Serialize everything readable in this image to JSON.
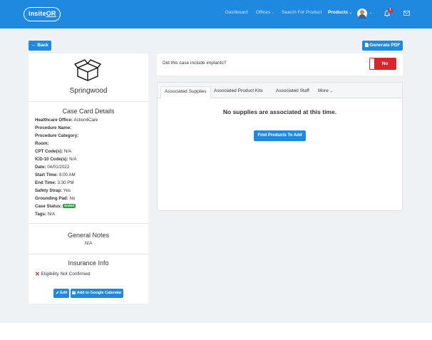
{
  "header": {
    "logo_text": "insite",
    "logo_or": "OR",
    "nav": [
      "Dashboard",
      "Offices",
      "Search For Product",
      "Products"
    ],
    "chevron": "⌄",
    "notification_count": "1",
    "brand_color": "#1f89e0"
  },
  "toolbar": {
    "back_label": "← Back",
    "pdf_label": "Generate PDF"
  },
  "case": {
    "name": "Springwood",
    "details_title": "Case Card Details",
    "details": [
      {
        "label": "Healthcare Office:",
        "value": "Action4Care"
      },
      {
        "label": "Procedure Name:",
        "value": ""
      },
      {
        "label": "Procedure Category:",
        "value": ""
      },
      {
        "label": "Room:",
        "value": ""
      },
      {
        "label": "CPT Code(s):",
        "value": "N/A"
      },
      {
        "label": "ICD-10 Code(s):",
        "value": "N/A"
      },
      {
        "label": "Date:",
        "value": "04/01/2022"
      },
      {
        "label": "Start Time:",
        "value": "8:00 AM"
      },
      {
        "label": "End Time:",
        "value": "3:30 PM"
      },
      {
        "label": "Safety Strap:",
        "value": "Yes"
      },
      {
        "label": "Grounding Pad:",
        "value": "No"
      },
      {
        "label": "Case Status:",
        "value": "Ended"
      },
      {
        "label": "Tags:",
        "value": "N/A"
      }
    ],
    "general_notes_title": "General Notes",
    "general_notes_value": "N/A",
    "insurance_title": "Insurance Info",
    "eligibility": "Eligibility Not Confirmed",
    "edit_label": "Edit",
    "gcal_label": "Add to Google Calendar"
  },
  "implants": {
    "question": "Did this case include implants?",
    "toggle_value": "No"
  },
  "tabs": {
    "items": [
      "Associated Supplies",
      "Associated Product Kits",
      "Associated Staff",
      "More"
    ],
    "empty_message": "No supplies are associated at this time.",
    "find_label": "Find Products To Add"
  }
}
